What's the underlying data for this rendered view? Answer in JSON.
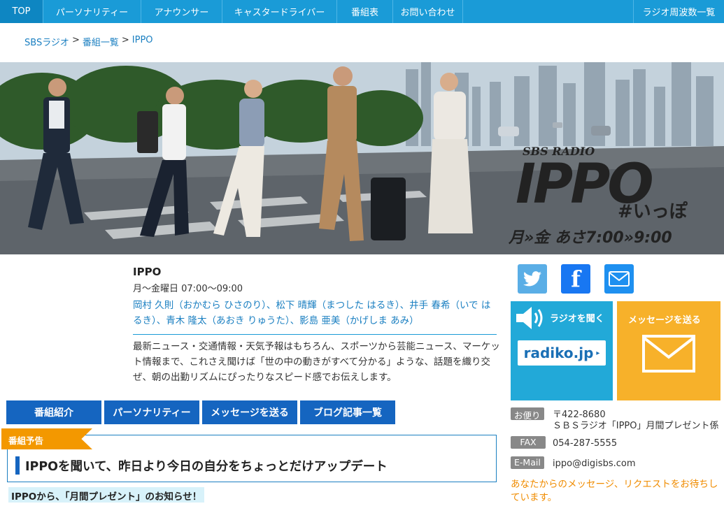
{
  "nav": {
    "items": [
      {
        "label": "TOP",
        "width": 62
      },
      {
        "label": "パーソナリティー",
        "width": 140
      },
      {
        "label": "アナウンサー",
        "width": 116
      },
      {
        "label": "キャスタードライバー",
        "width": 164
      },
      {
        "label": "番組表",
        "width": 80
      },
      {
        "label": "お問い合わせ",
        "width": 100
      }
    ],
    "right_item": "ラジオ周波数一覧"
  },
  "breadcrumb": {
    "items": [
      "SBSラジオ",
      "番組一覧",
      "IPPO"
    ],
    "separator": ">"
  },
  "hero": {
    "sbs_radio": "SBS RADIO",
    "logo_text": "IPPO",
    "hashtag": "#いっぽ",
    "schedule": "月»金 あさ7:00»9:00"
  },
  "program": {
    "title": "IPPO",
    "time": "月～金曜日 07:00～09:00",
    "hosts": "岡村 久則（おかむら ひさのり）、松下 晴輝（まつした はるき）、井手 春希（いで はるき）、青木 隆太（あおき りゅうた）、影島 亜美（かげしま あみ）",
    "description": "最新ニュース・交通情報・天気予報はもちろん、スポーツから芸能ニュース、マーケット情報まで、これさえ聞けば「世の中の動きがすべて分かる」ような、話題を織り交ぜ、朝の出勤リズムにぴったりなスピード感でお伝えします。"
  },
  "tabs": [
    {
      "label": "番組紹介",
      "width": 136
    },
    {
      "label": "パーソナリティー",
      "width": 136
    },
    {
      "label": "メッセージを送る",
      "width": 136
    },
    {
      "label": "ブログ記事一覧",
      "width": 136
    }
  ],
  "preview": {
    "ribbon": "番組予告",
    "headline": "IPPOを聞いて、昨日より今日の自分をちょっとだけアップデート",
    "notice": "IPPOから、「月間プレゼント」のお知らせ！"
  },
  "social": {
    "twitter_icon": "twitter-icon",
    "facebook_icon": "facebook-icon",
    "mail_icon": "mail-icon"
  },
  "panels": {
    "radio_label": "ラジオを聞く",
    "radiko_logo": "radiko.jp",
    "message_label": "メッセージを送る"
  },
  "contact": {
    "mail_badge": "お便り",
    "postal": "〒422-8680",
    "address": "ＳＢＳラジオ「IPPO」月間プレゼント係",
    "fax_badge": "FAX",
    "fax": "054-287-5555",
    "email_badge": "E-Mail",
    "email": "ippo@digisbs.com",
    "note": "あなたからのメッセージ、リクエストをお待ちしています。"
  },
  "colors": {
    "nav": "#1a9bd7",
    "tab": "#1565c0",
    "accent_orange": "#f39800",
    "radio_panel": "#22a9d8",
    "message_panel": "#f7b12a"
  }
}
